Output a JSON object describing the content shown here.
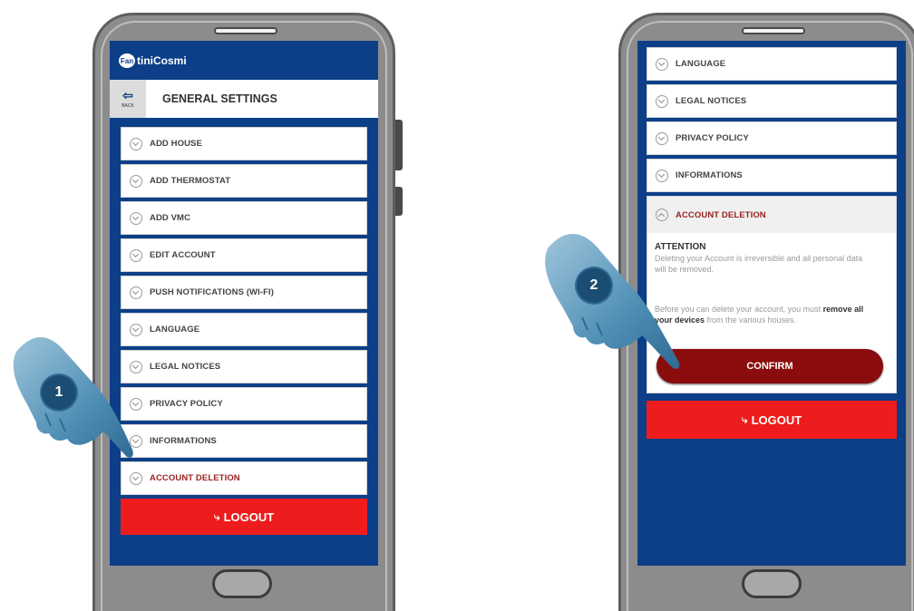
{
  "left": {
    "logo": {
      "mark": "Fan",
      "text": "tiniCosmi"
    },
    "back_label": "BACK",
    "title": "GENERAL SETTINGS",
    "items": [
      {
        "label": "ADD HOUSE"
      },
      {
        "label": "ADD THERMOSTAT"
      },
      {
        "label": "ADD VMC"
      },
      {
        "label": "EDIT ACCOUNT"
      },
      {
        "label": "PUSH NOTIFICATIONS (WI-FI)"
      },
      {
        "label": "LANGUAGE"
      },
      {
        "label": "LEGAL NOTICES"
      },
      {
        "label": "PRIVACY POLICY"
      },
      {
        "label": "INFORMATIONS"
      },
      {
        "label": "ACCOUNT DELETION"
      }
    ],
    "logout_label": "LOGOUT",
    "step": "1"
  },
  "right": {
    "items": [
      {
        "label": "LANGUAGE"
      },
      {
        "label": "LEGAL NOTICES"
      },
      {
        "label": "PRIVACY POLICY"
      },
      {
        "label": "INFORMATIONS"
      }
    ],
    "expanded": {
      "label": "ACCOUNT DELETION",
      "attention_title": "ATTENTION",
      "attention_text": "Deleting your Account is irreversible and all personal data will be removed.",
      "info_prefix": "Before you can delete your account, you must",
      "info_bold": "remove all your devices",
      "info_suffix": "from the various houses.",
      "confirm_label": "CONFIRM"
    },
    "logout_label": "LOGOUT",
    "step": "2"
  },
  "colors": {
    "brand_blue": "#0c3f87",
    "logout_red": "#ee1c1c",
    "confirm_dark_red": "#8a0c0c",
    "deletion_text_red": "#9c1f1f"
  }
}
